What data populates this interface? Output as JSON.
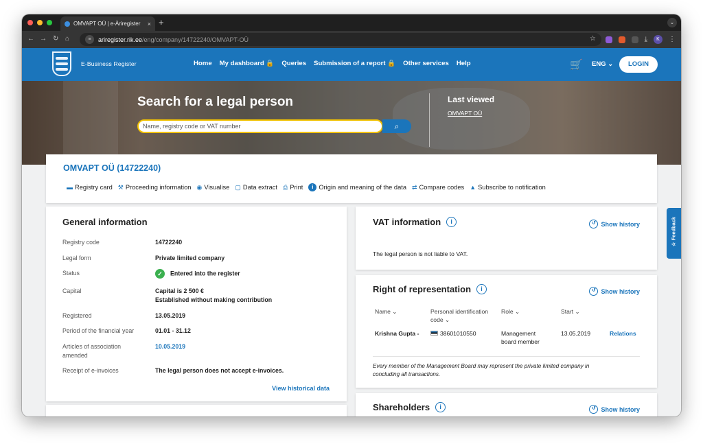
{
  "browser": {
    "tab_title": "OMVAPT OÜ | e-Äriregister",
    "tab_close": "×",
    "new_tab": "+",
    "url_host": "ariregister.rik.ee",
    "url_path": "/eng/company/14722240/OMVAPT-OÜ",
    "profile_initial": "K"
  },
  "site": {
    "brand": "E-Business Register",
    "nav": [
      "Home",
      "My dashboard 🔒",
      "Queries",
      "Submission of a report 🔒",
      "Other services",
      "Help"
    ],
    "lang": "ENG ⌄",
    "login": "LOGIN"
  },
  "hero": {
    "title": "Search for a legal person",
    "search_placeholder": "Name, registry code or VAT number",
    "last_viewed_title": "Last viewed",
    "last_viewed_link": "OMVAPT OÜ"
  },
  "company": {
    "name": "OMVAPT OÜ (14722240)",
    "actions": [
      {
        "icon": "folder-icon",
        "label": "Registry card"
      },
      {
        "icon": "gavel-icon",
        "label": "Proceeding information"
      },
      {
        "icon": "eye-icon",
        "label": "Visualise"
      },
      {
        "icon": "pdf-icon",
        "label": "Data extract"
      },
      {
        "icon": "printer-icon",
        "label": "Print"
      },
      {
        "icon": "info-circle-icon",
        "label": "Origin and meaning of the data"
      },
      {
        "icon": "compare-icon",
        "label": "Compare codes"
      },
      {
        "icon": "bell-icon",
        "label": "Subscribe to notification"
      }
    ]
  },
  "general": {
    "title": "General information",
    "rows": [
      {
        "key": "Registry code",
        "value": "14722240"
      },
      {
        "key": "Legal form",
        "value": "Private limited company"
      },
      {
        "key": "Status",
        "value": "Entered into the register"
      },
      {
        "key": "Capital",
        "value": "Capital is 2 500 €",
        "value2": "Established without making contribution"
      },
      {
        "key": "Registered",
        "value": "13.05.2019"
      },
      {
        "key": "Period of the financial year",
        "value": "01.01 - 31.12"
      },
      {
        "key": "Articles of association amended",
        "value": "10.05.2019"
      },
      {
        "key": "Receipt of e-invoices",
        "value": "The legal person does not accept e-invoices."
      }
    ],
    "history_link": "View historical data"
  },
  "vat": {
    "title": "VAT information",
    "show_history": "Show history",
    "text": "The legal person is not liable to VAT."
  },
  "representation": {
    "title": "Right of representation",
    "show_history": "Show history",
    "columns": {
      "name": "Name ⌄",
      "pid": "Personal identification",
      "pid2": "code ⌄",
      "role": "Role ⌄",
      "start": "Start ⌄"
    },
    "row": {
      "name": "Krishna Gupta -",
      "code": "38601010550",
      "role": "Management",
      "role2": "board member",
      "start": "13.05.2019",
      "relations": "Relations"
    },
    "note": "Every member of the Management Board may represent the private limited company in",
    "note2": "concluding all transactions."
  },
  "shareholders": {
    "title": "Shareholders",
    "show_history": "Show history"
  },
  "feedback": "☆ Feedback",
  "colors": {
    "accent": "#1b75bb",
    "status_green": "#3bb04f",
    "search_border": "#f2c200"
  }
}
